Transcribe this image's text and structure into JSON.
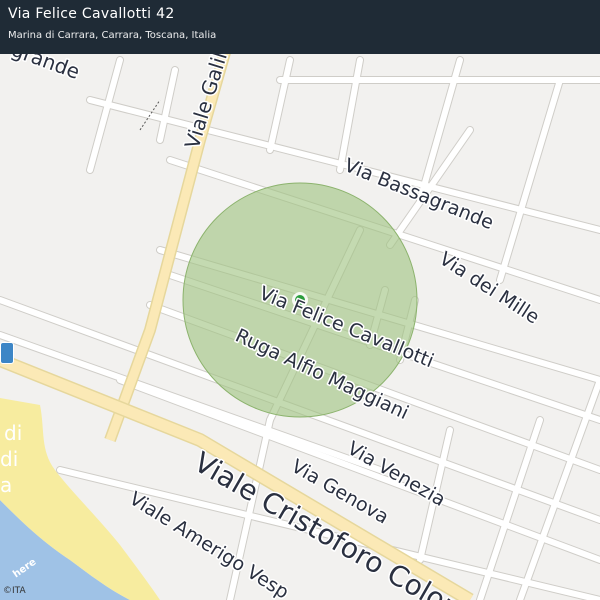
{
  "header": {
    "title": "Via Felice Cavallotti 42",
    "subtitle": "Marina di Carrara, Carrara, Toscana, Italia"
  },
  "streets": {
    "viale_galilei": "Viale Galile",
    "bassagrande_top": "grande",
    "via_bassagrande": "Via Bassagrande",
    "via_dei_mille": "Via dei Mille",
    "via_felice_cavallotti": "Via Felice Cavallotti",
    "ruga_alfio_maggiani": "Ruga Alfio Maggiani",
    "via_venezia": "Via Venezia",
    "via_genova": "Via Genova",
    "viale_cristoforo_colombo": "Viale Cristoforo Colon",
    "viale_amerigo_vespucci": "Viale Amerigo Vesp",
    "beach_fragment_1": "di",
    "beach_fragment_2": "di",
    "beach_fragment_3": "a"
  },
  "marker": {
    "accuracy_fill": "#9fc481",
    "dot_color": "#2a9d3c"
  },
  "colors": {
    "header_bg": "#1f2b36",
    "map_bg": "#f2f1ef",
    "road": "#ffffff",
    "road_outline": "#cfcdc8",
    "main_road": "#fbe9b6",
    "beach": "#f7ec9f",
    "sea": "#9fc2e6"
  },
  "attribution": {
    "logo": "here",
    "copyright": "©ITA"
  }
}
